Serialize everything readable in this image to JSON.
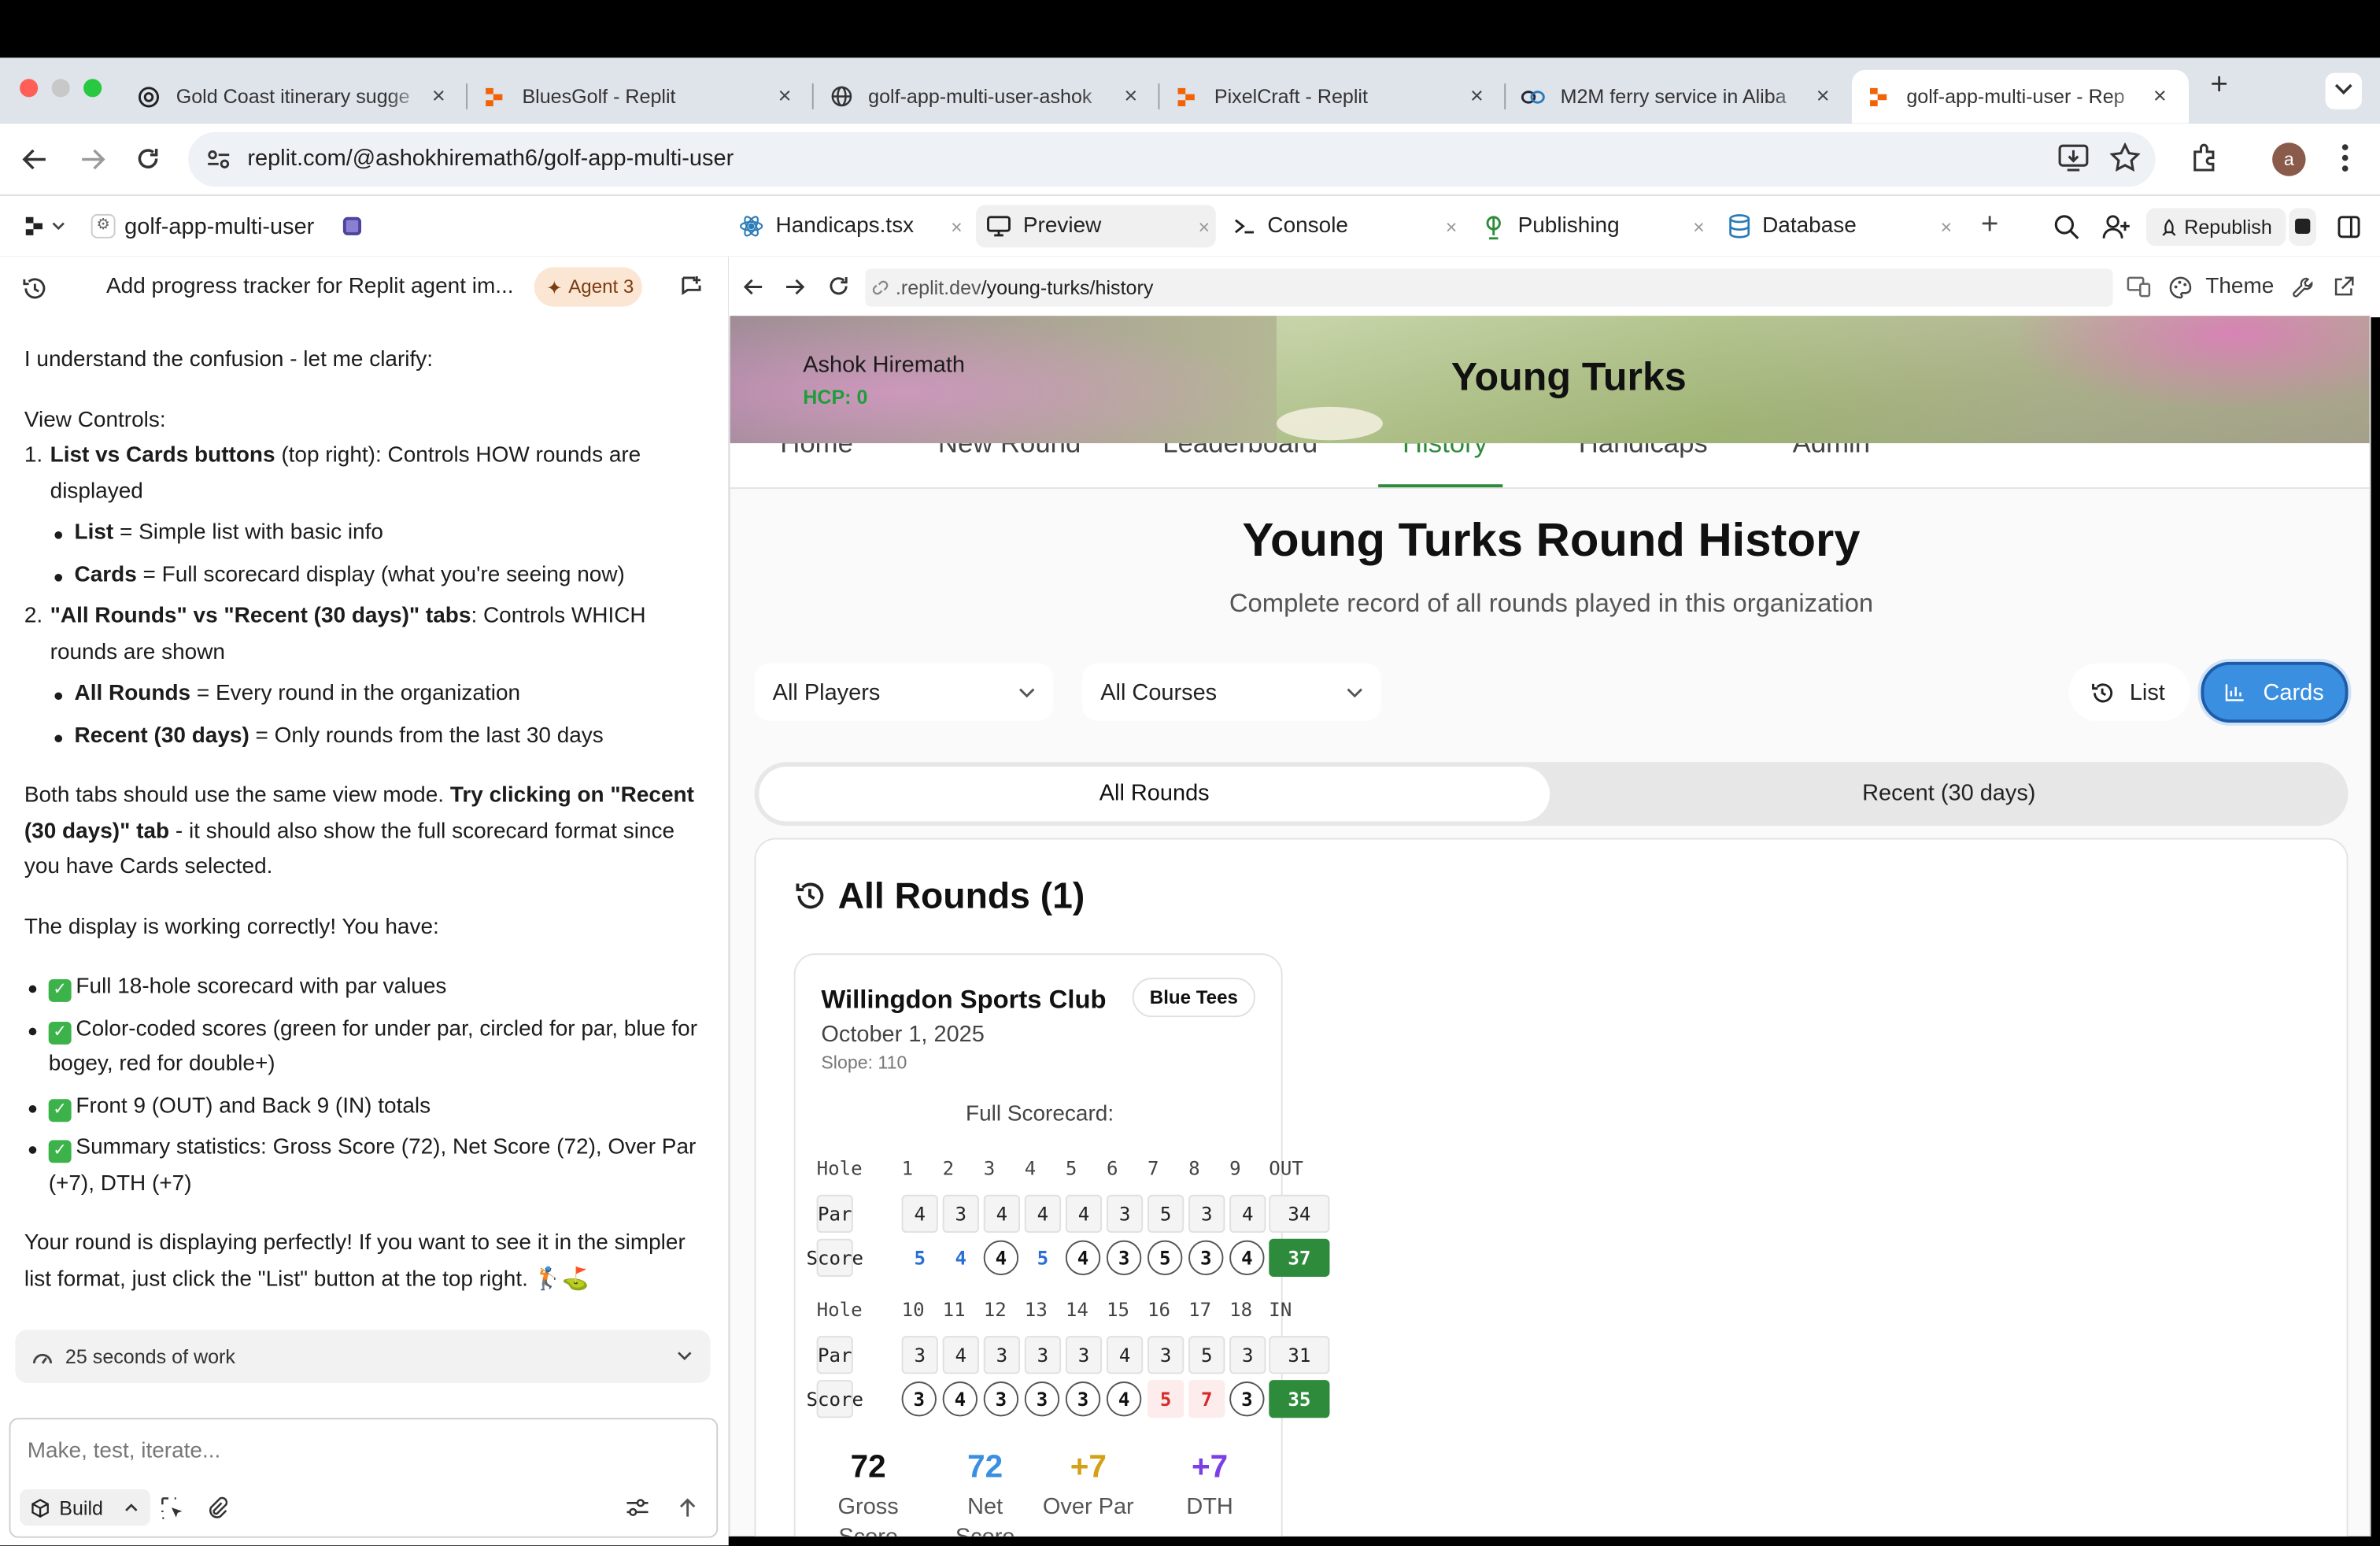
{
  "browser": {
    "tabs": [
      {
        "title": "Gold Coast itinerary sugge",
        "icon": "openai-icon"
      },
      {
        "title": "BluesGolf - Replit",
        "icon": "replit-icon"
      },
      {
        "title": "golf-app-multi-user-ashok",
        "icon": "globe-icon"
      },
      {
        "title": "PixelCraft - Replit",
        "icon": "replit-icon"
      },
      {
        "title": "M2M ferry service in Aliba",
        "icon": "m2m-icon"
      },
      {
        "title": "golf-app-multi-user - Rep",
        "icon": "replit-icon"
      }
    ],
    "url": "replit.com/@ashokhiremath6/golf-app-multi-user",
    "profile_initial": "a"
  },
  "replit": {
    "project": "golf-app-multi-user",
    "chat_title": "Add progress tracker for Replit agent im...",
    "agent_badge": "Agent 3",
    "chat": {
      "intro": "I understand the confusion - let me clarify:",
      "view_controls": "View Controls:",
      "item1_bold": "List vs Cards buttons",
      "item1_rest": " (top right): Controls HOW rounds are displayed",
      "item1_sub1_bold": "List",
      "item1_sub1_rest": " = Simple list with basic info",
      "item1_sub2_bold": "Cards",
      "item1_sub2_rest": " = Full scorecard display (what you're seeing now)",
      "item2_bold": "\"All Rounds\" vs \"Recent (30 days)\" tabs",
      "item2_rest": ": Controls WHICH rounds are shown",
      "item2_sub1_bold": "All Rounds",
      "item2_sub1_rest": " = Every round in the organization",
      "item2_sub2_bold": "Recent (30 days)",
      "item2_sub2_rest": " = Only rounds from the last 30 days",
      "p2_a": "Both tabs should use the same view mode. ",
      "p2_bold": "Try clicking on \"Recent (30 days)\" tab",
      "p2_b": " - it should also show the full scorecard format since you have Cards selected.",
      "p3": "The display is working correctly! You have:",
      "checks": [
        "Full 18-hole scorecard with par values",
        "Color-coded scores (green for under par, circled for par, blue for bogey, red for double+)",
        "Front 9 (OUT) and Back 9 (IN) totals",
        "Summary statistics: Gross Score (72), Net Score (72), Over Par (+7), DTH (+7)"
      ],
      "p4": "Your round is displaying perfectly! If you want to see it in the simpler list format, just click the \"List\" button at the top right. 🏌️⛳"
    },
    "work_summary": "25 seconds of work",
    "input_placeholder": "Make, test, iterate...",
    "build_label": "Build",
    "tabs": [
      {
        "label": "Handicaps.tsx"
      },
      {
        "label": "Preview"
      },
      {
        "label": "Console"
      },
      {
        "label": "Publishing"
      },
      {
        "label": "Database"
      }
    ],
    "republish_label": "Republish",
    "preview_url_prefix": ".replit.dev",
    "preview_url_path": "/young-turks/history",
    "theme_label": "Theme"
  },
  "app": {
    "user_name": "Ashok Hiremath",
    "hcp": "HCP: 0",
    "org_title": "Young Turks",
    "nav": [
      "Home",
      "New Round",
      "Leaderboard",
      "History",
      "Handicaps",
      "Admin"
    ],
    "page_title": "Young Turks Round History",
    "page_subtitle": "Complete record of all rounds played in this organization",
    "filter_players": "All Players",
    "filter_courses": "All Courses",
    "list_label": "List",
    "cards_label": "Cards",
    "tab_all": "All Rounds",
    "tab_recent": "Recent (30 days)",
    "section_title": "All Rounds (1)",
    "card": {
      "course": "Willingdon Sports Club",
      "tees": "Blue Tees",
      "date": "October 1, 2025",
      "slope": "Slope: 110",
      "scorecard_title": "Full Scorecard:",
      "hole_label": "Hole",
      "par_label": "Par",
      "score_label": "Score",
      "out_label": "OUT",
      "in_label": "IN",
      "front_holes": [
        "1",
        "2",
        "3",
        "4",
        "5",
        "6",
        "7",
        "8",
        "9"
      ],
      "front_par": [
        "4",
        "3",
        "4",
        "4",
        "4",
        "3",
        "5",
        "3",
        "4"
      ],
      "front_par_total": "34",
      "front_scores": [
        {
          "v": "5",
          "s": "blue"
        },
        {
          "v": "4",
          "s": "blue"
        },
        {
          "v": "4",
          "s": "circle"
        },
        {
          "v": "5",
          "s": "blue"
        },
        {
          "v": "4",
          "s": "circle"
        },
        {
          "v": "3",
          "s": "circle"
        },
        {
          "v": "5",
          "s": "circle"
        },
        {
          "v": "3",
          "s": "circle"
        },
        {
          "v": "4",
          "s": "circle"
        }
      ],
      "front_score_total": "37",
      "back_holes": [
        "10",
        "11",
        "12",
        "13",
        "14",
        "15",
        "16",
        "17",
        "18"
      ],
      "back_par": [
        "3",
        "4",
        "3",
        "3",
        "3",
        "4",
        "3",
        "5",
        "3"
      ],
      "back_par_total": "31",
      "back_scores": [
        {
          "v": "3",
          "s": "circle"
        },
        {
          "v": "4",
          "s": "circle"
        },
        {
          "v": "3",
          "s": "circle"
        },
        {
          "v": "3",
          "s": "circle"
        },
        {
          "v": "3",
          "s": "circle"
        },
        {
          "v": "4",
          "s": "circle"
        },
        {
          "v": "5",
          "s": "red"
        },
        {
          "v": "7",
          "s": "red"
        },
        {
          "v": "3",
          "s": "circle"
        }
      ],
      "back_score_total": "35",
      "stats": [
        {
          "value": "72",
          "label": "Gross Score",
          "color": "#111111"
        },
        {
          "value": "72",
          "label": "Net Score",
          "color": "#3b8fe0"
        },
        {
          "value": "+7",
          "label": "Over Par",
          "color": "#d4a017"
        },
        {
          "value": "+7",
          "label": "DTH",
          "color": "#7b3fe4"
        }
      ]
    }
  },
  "colors": {
    "accent_blue": "#3b8fe0",
    "green": "#2f8b3c",
    "hcp_green": "#1e9e3a",
    "red": "#d62b2b",
    "badge_bg": "#fbe5d3"
  }
}
